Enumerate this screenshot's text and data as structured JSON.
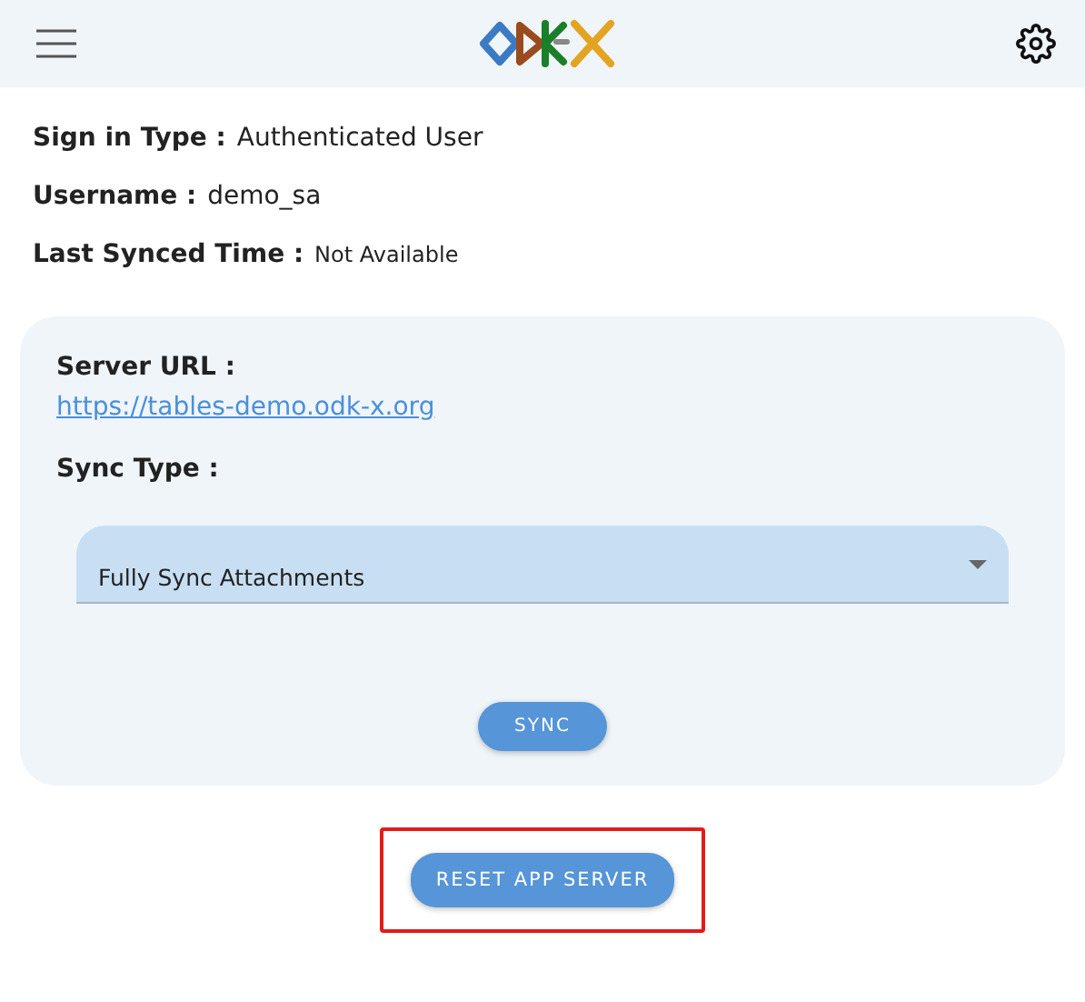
{
  "info": [
    {
      "label": "Sign in Type :",
      "value": "Authenticated User",
      "kind": "normal"
    },
    {
      "label": "Username :",
      "value": "demo_sa",
      "kind": "normal"
    },
    {
      "label": "Last Synced Time :",
      "value": "Not Available",
      "kind": "small"
    }
  ],
  "server": {
    "label": "Server URL :",
    "url": "https://tables-demo.odk-x.org"
  },
  "sync_type": {
    "label": "Sync Type :",
    "value": "Fully Sync Attachments"
  },
  "sync_button": "SYNC",
  "reset_button": {
    "label": "RESET APP SERVER",
    "highlighted": true
  }
}
